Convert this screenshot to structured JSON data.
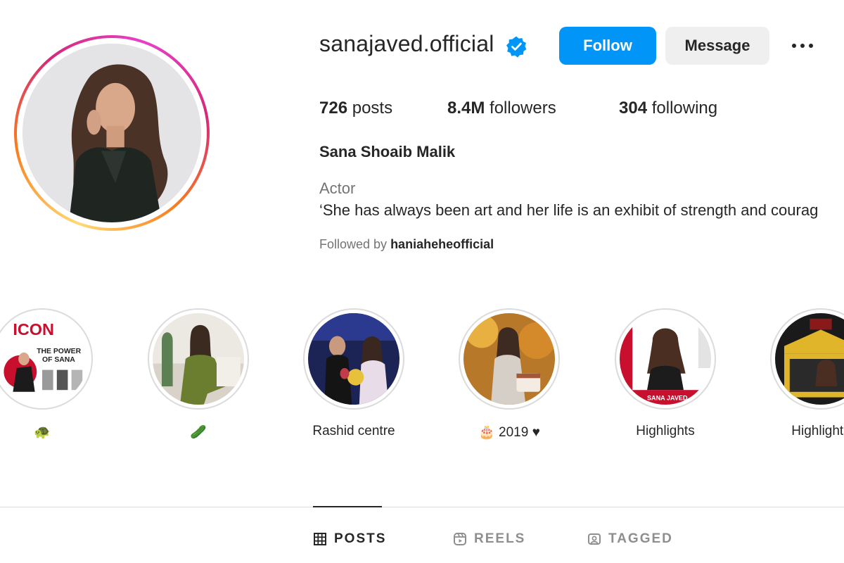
{
  "profile": {
    "username": "sanajaved.official",
    "verified_icon": "verified-badge-icon",
    "follow_label": "Follow",
    "message_label": "Message",
    "more_icon": "more-options-icon"
  },
  "stats": {
    "posts_count": "726",
    "posts_label": "posts",
    "followers_count": "8.4M",
    "followers_label": "followers",
    "following_count": "304",
    "following_label": "following"
  },
  "bio": {
    "full_name": "Sana Shoaib Malik",
    "category": "Actor",
    "text": "‘She has always been art and her life is an exhibit of strength and courag",
    "followed_by_prefix": "Followed by",
    "followed_by_user": "haniaheheofficial"
  },
  "highlights": [
    {
      "label": "🐢"
    },
    {
      "label": "🥒"
    },
    {
      "label": "Rashid centre"
    },
    {
      "label": "🎂 2019 ♥"
    },
    {
      "label": "Highlights"
    },
    {
      "label": "Highlights"
    }
  ],
  "highlight_cover_text": {
    "icon_title": "ICON",
    "icon_subtitle_1": "THE POWER",
    "icon_subtitle_2": "OF SANA",
    "name_tag": "SANA JAVED"
  },
  "tabs": {
    "posts": "POSTS",
    "reels": "REELS",
    "tagged": "TAGGED"
  },
  "colors": {
    "accent": "#0095f6",
    "verified": "#0095f6",
    "text_primary": "#262626",
    "text_secondary": "#737373",
    "button_secondary": "#efefef"
  }
}
